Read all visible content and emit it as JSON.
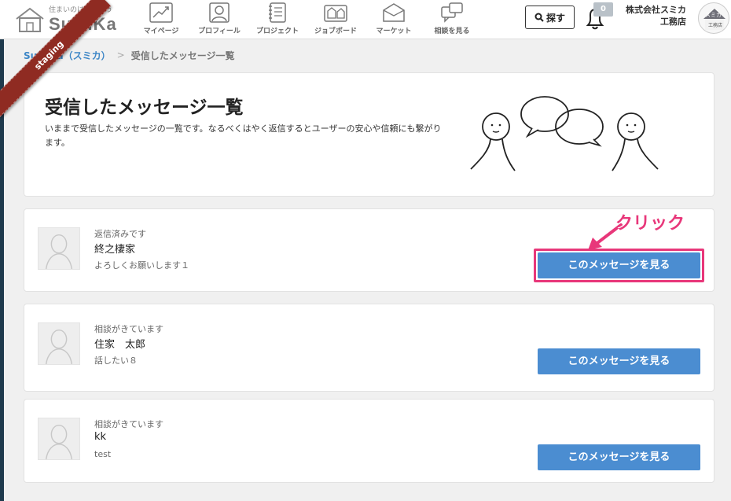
{
  "header": {
    "logo_tagline": "住まいのはなしそう",
    "logo_text": "SuMiKa",
    "nav": [
      {
        "label": "マイページ",
        "icon": "chart-icon"
      },
      {
        "label": "プロフィール",
        "icon": "profile-icon"
      },
      {
        "label": "プロジェクト",
        "icon": "notebook-icon"
      },
      {
        "label": "ジョブボード",
        "icon": "jobboard-icon"
      },
      {
        "label": "マーケット",
        "icon": "market-icon"
      },
      {
        "label": "相談を見る",
        "icon": "chat-icon"
      }
    ],
    "search_label": "探す",
    "notification_count": "0",
    "company_name": "株式会社スミカ工務店",
    "avatar_text_1": "スミカ",
    "avatar_text_2": "工務店"
  },
  "ribbon": {
    "label": "staging"
  },
  "breadcrumb": {
    "home": "SuMiKa（スミカ）",
    "current": "受信したメッセージ一覧"
  },
  "hero": {
    "title": "受信したメッセージ一覧",
    "description": "いままで受信したメッセージの一覧です。なるべくはやく返信するとユーザーの安心や信頼にも繋がります。"
  },
  "messages": [
    {
      "status": "返信済みです",
      "name": "終之棲家",
      "preview": "よろしくお願いします１",
      "button": "このメッセージを見る"
    },
    {
      "status": "相談がきています",
      "name": "住家　太郎",
      "preview": "話したい８",
      "button": "このメッセージを見る"
    },
    {
      "status": "相談がきています",
      "name": "kk",
      "preview": "test",
      "button": "このメッセージを見る"
    }
  ],
  "annotation": {
    "label": "クリック",
    "color": "#e8377a"
  },
  "colors": {
    "accent": "#4b8dd1",
    "link": "#3d86c6",
    "ribbon": "#8f2b22"
  }
}
